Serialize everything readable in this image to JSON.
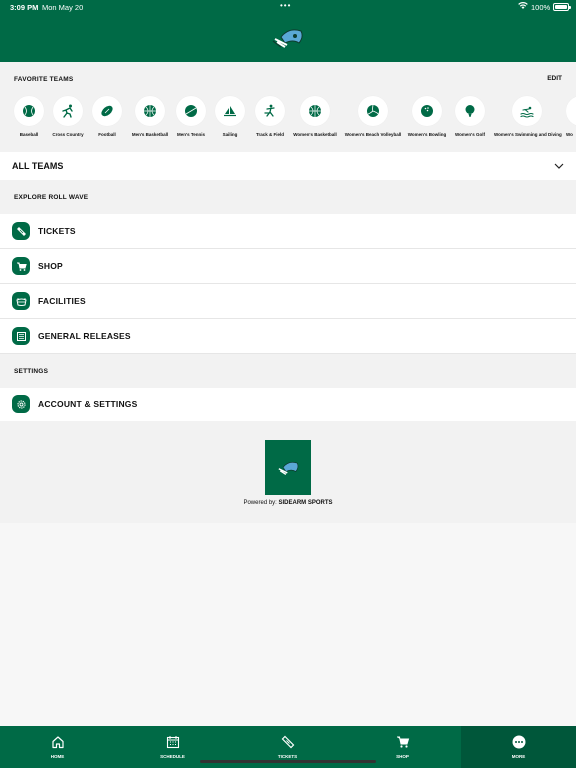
{
  "status": {
    "time": "3:09 PM",
    "date": "Mon May 20",
    "dots": "•••",
    "battery": "100%"
  },
  "colors": {
    "brand": "#006a46",
    "brand_dark": "#00573a",
    "background": "#f2f2f2"
  },
  "favorites": {
    "title": "FAVORITE TEAMS",
    "edit": "EDIT",
    "teams": [
      {
        "label": "Baseball",
        "icon": "baseball-icon"
      },
      {
        "label": "Cross Country",
        "icon": "runner-icon"
      },
      {
        "label": "Football",
        "icon": "football-icon"
      },
      {
        "label": "Men's Basketball",
        "icon": "basketball-icon"
      },
      {
        "label": "Men's Tennis",
        "icon": "tennis-icon"
      },
      {
        "label": "Sailing",
        "icon": "sailboat-icon"
      },
      {
        "label": "Track & Field",
        "icon": "hurdler-icon"
      },
      {
        "label": "Women's Basketball",
        "icon": "basketball-icon"
      },
      {
        "label": "Women's Beach Volleyball",
        "icon": "volleyball-icon"
      },
      {
        "label": "Women's Bowling",
        "icon": "bowling-icon"
      },
      {
        "label": "Women's Golf",
        "icon": "golf-icon"
      },
      {
        "label": "Women's Swimming and Diving",
        "icon": "swimmer-icon"
      },
      {
        "label": "Wo",
        "icon": "team-icon"
      }
    ]
  },
  "all_teams": {
    "label": "ALL TEAMS"
  },
  "explore": {
    "title": "EXPLORE ROLL WAVE",
    "items": [
      {
        "label": "TICKETS",
        "icon": "ticket-icon"
      },
      {
        "label": "SHOP",
        "icon": "cart-icon"
      },
      {
        "label": "FACILITIES",
        "icon": "stadium-icon"
      },
      {
        "label": "GENERAL RELEASES",
        "icon": "newspaper-icon"
      }
    ]
  },
  "settings": {
    "title": "SETTINGS",
    "items": [
      {
        "label": "ACCOUNT & SETTINGS",
        "icon": "gear-icon"
      }
    ]
  },
  "footer": {
    "powered_prefix": "Powered by:",
    "powered_brand": "SIDEARM SPORTS"
  },
  "tabs": [
    {
      "label": "HOME",
      "icon": "home-icon"
    },
    {
      "label": "SCHEDULE",
      "icon": "calendar-icon"
    },
    {
      "label": "TICKETS",
      "icon": "ticket-icon"
    },
    {
      "label": "SHOP",
      "icon": "cart-icon"
    },
    {
      "label": "MORE",
      "icon": "more-icon",
      "active": true
    }
  ]
}
